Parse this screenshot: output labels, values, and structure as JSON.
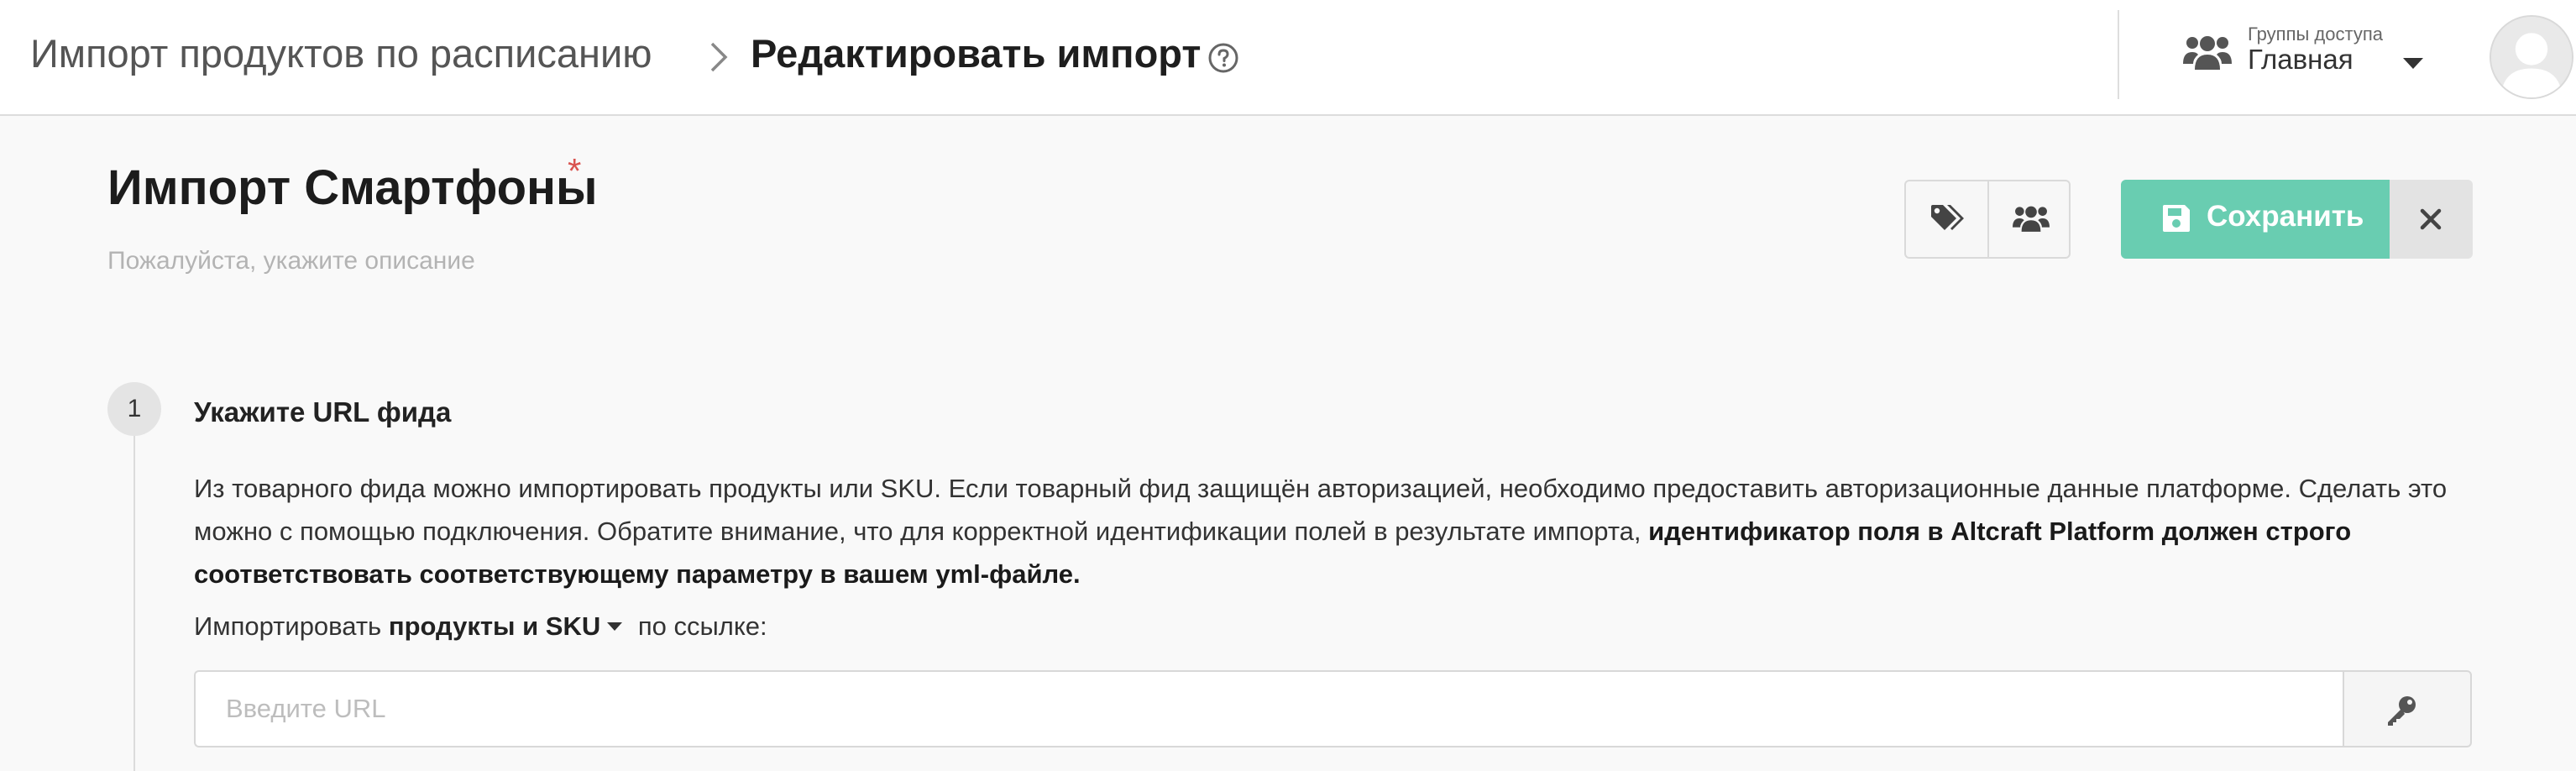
{
  "header": {
    "breadcrumb_parent": "Импорт продуктов по расписанию",
    "breadcrumb_current": "Редактировать импорт",
    "access": {
      "label": "Группы доступа",
      "value": "Главная"
    }
  },
  "form": {
    "title": "Импорт Смартфоны",
    "required_mark": "*",
    "description_placeholder": "Пожалуйста, укажите описание",
    "save_label": "Сохранить"
  },
  "step1": {
    "number": "1",
    "title": "Укажите URL фида",
    "paragraph_plain": "Из товарного фида можно импортировать продукты или SKU. Если товарный фид защищён авторизацией, необходимо предоставить авторизационные данные платформе. Сделать это можно с помощью подключения. Обратите внимание, что для корректной идентификации полей в результате импорта, ",
    "paragraph_bold": "идентификатор поля в Altcraft Platform должен строго соответствовать соответствующему параметру в вашем yml-файле.",
    "import_prefix": "Импортировать",
    "import_selected": "продукты и SKU",
    "import_suffix": "по ссылке:",
    "url_placeholder": "Введите URL",
    "url_value": ""
  },
  "colors": {
    "accent": "#69cdb1",
    "required": "#d9534f"
  },
  "icons": [
    "chevron-right-icon",
    "help-circle-icon",
    "users-icon",
    "caret-down-icon",
    "avatar-icon",
    "tag-icon",
    "save-icon",
    "close-icon",
    "key-icon"
  ]
}
